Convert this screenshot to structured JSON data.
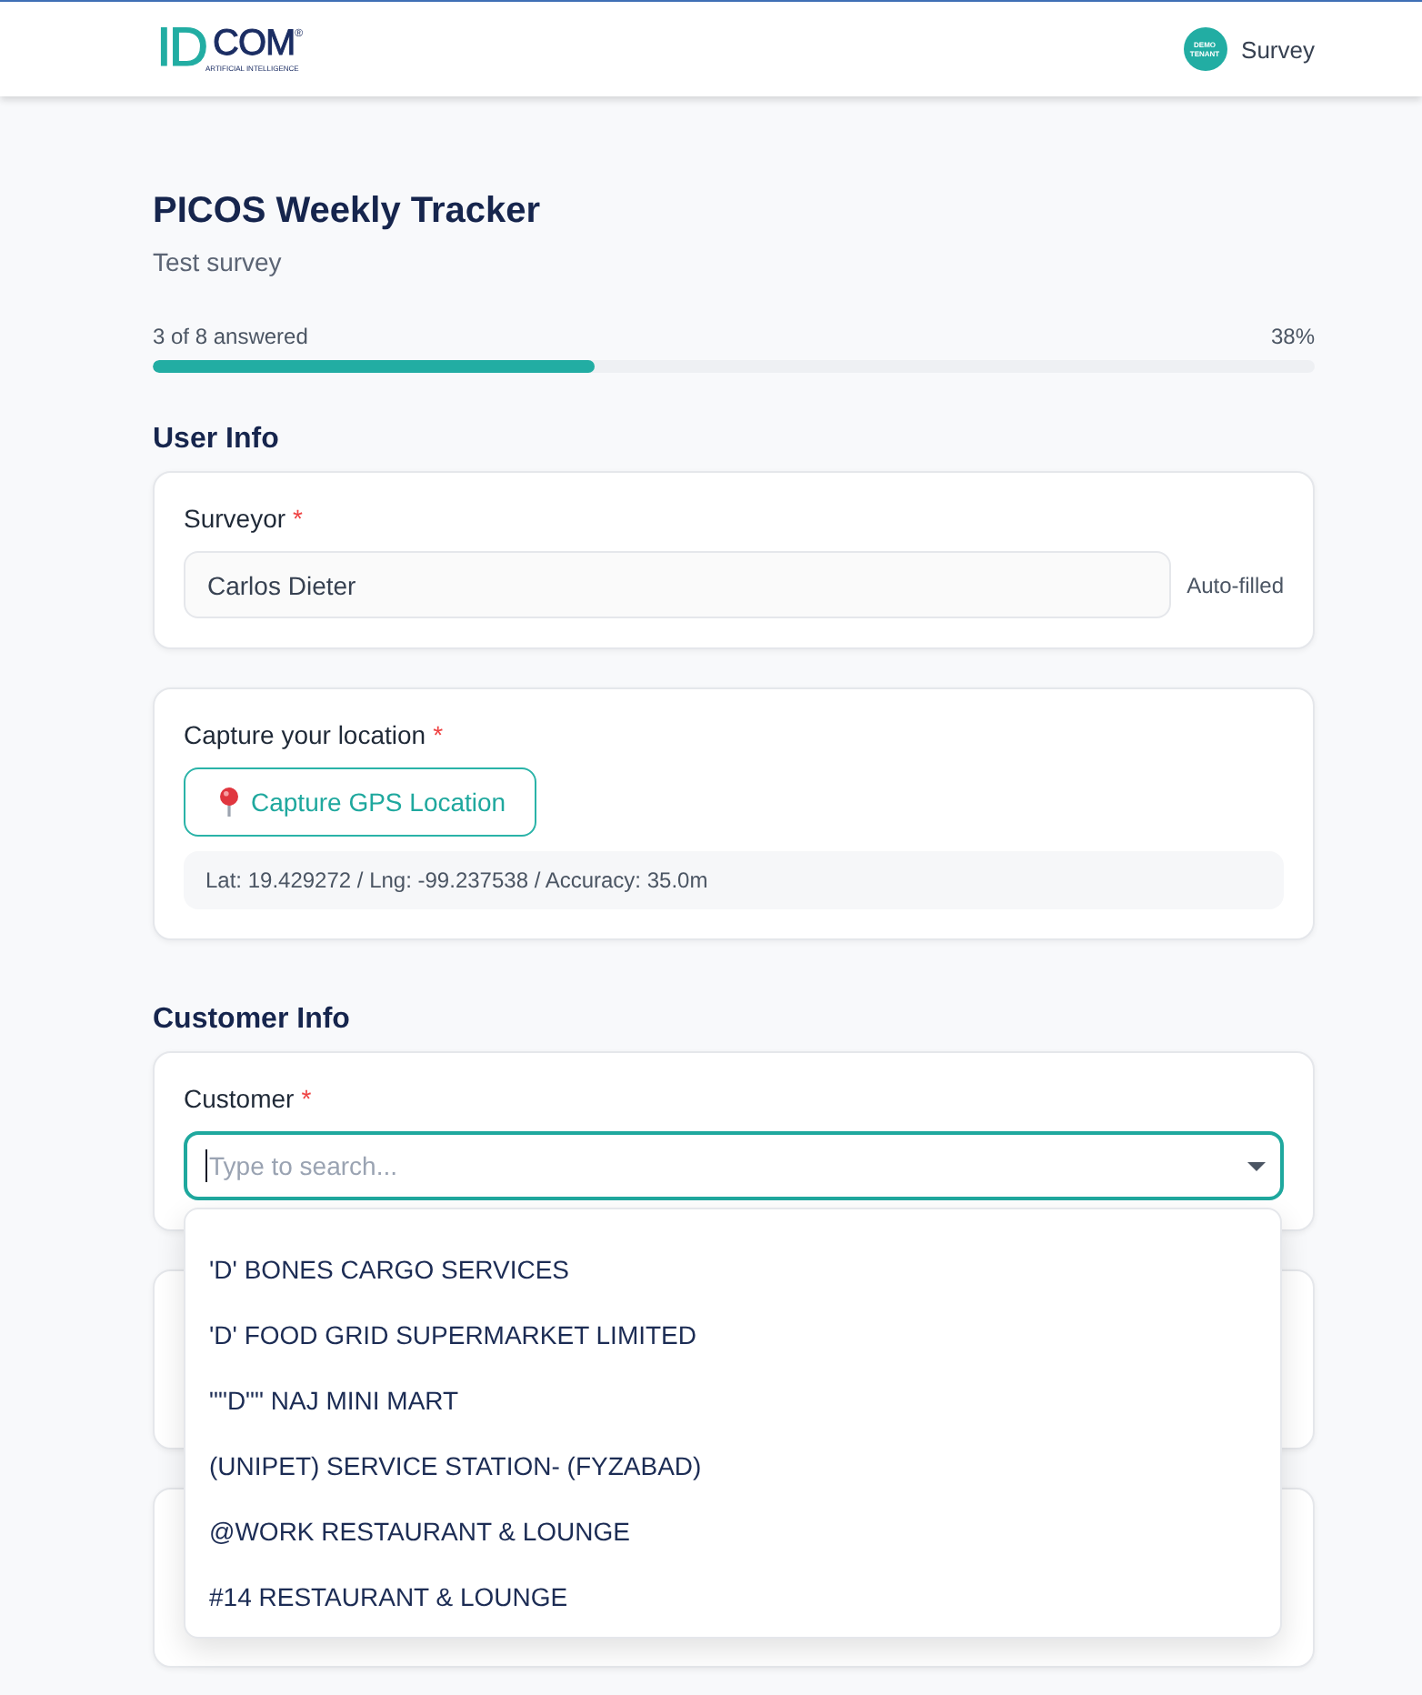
{
  "header": {
    "logo": {
      "mark": "ID",
      "wordmark": "COM",
      "registered": "®",
      "tagline": "ARTIFICIAL INTELLIGENCE"
    },
    "badge": "DEMO TENANT",
    "app_name": "Survey"
  },
  "survey": {
    "title": "PICOS Weekly Tracker",
    "subtitle": "Test survey"
  },
  "progress": {
    "label": "3 of 8 answered",
    "percent": "38%",
    "level": 0.38
  },
  "sections": [
    {
      "title": "User Info",
      "questions": [
        {
          "kind": "text",
          "label": "Surveyor",
          "required_mark": "*",
          "value": "Carlos Dieter",
          "note": "Auto-filled"
        },
        {
          "kind": "location",
          "label": "Capture your location",
          "required_mark": "*",
          "button": "Capture GPS Location",
          "result": "Lat: 19.429272 / Lng: -99.237538 / Accuracy: 35.0m"
        }
      ]
    },
    {
      "title": "Customer Info",
      "questions": [
        {
          "kind": "search",
          "label": "Customer",
          "required_mark": "*",
          "placeholder": "Type to search...",
          "focused": true,
          "expanded": true,
          "options": [
            {
              "label": "'D' BONES CARGO SERVICES",
              "selected": false
            },
            {
              "label": "'D' FOOD GRID SUPERMARKET LIMITED",
              "selected": false
            },
            {
              "label": "\"\"D\"\" NAJ MINI MART",
              "selected": false
            },
            {
              "label": "(UNIPET) SERVICE STATION- (FYZABAD)",
              "selected": false
            },
            {
              "label": "@WORK RESTAURANT & LOUNGE",
              "selected": false
            },
            {
              "label": "#14 RESTAURANT & LOUNGE",
              "selected": false
            }
          ]
        },
        {
          "kind": "covered"
        },
        {
          "kind": "covered"
        }
      ]
    }
  ]
}
